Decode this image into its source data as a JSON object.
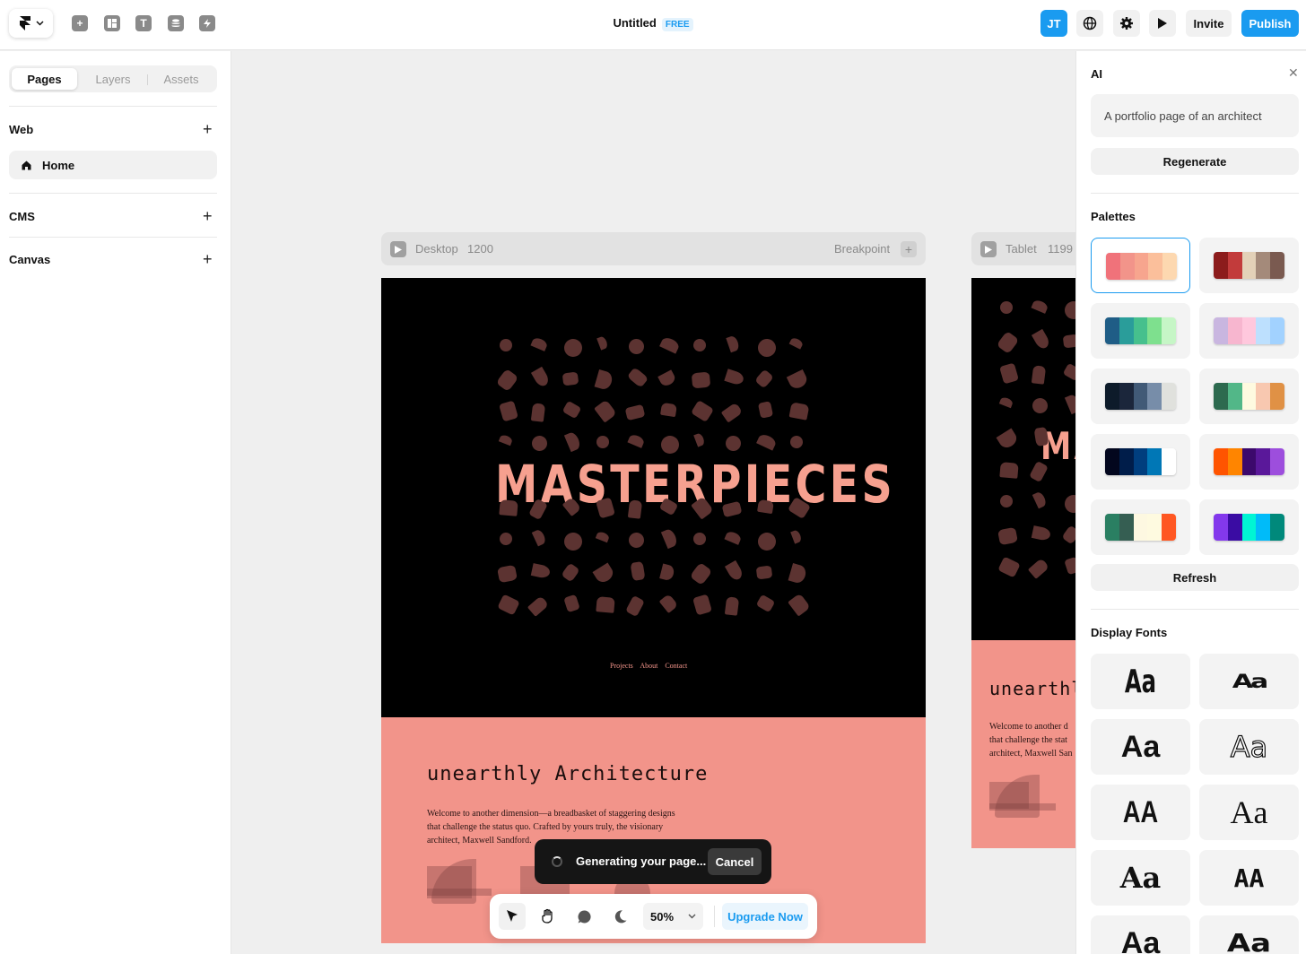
{
  "topbar": {
    "title": "Untitled",
    "plan_badge": "FREE",
    "avatar_initials": "JT",
    "invite_label": "Invite",
    "publish_label": "Publish",
    "accent_color": "#1a9bf0",
    "tool_icons": [
      "insert-icon",
      "layout-icon",
      "text-icon",
      "cms-icon",
      "plugins-icon"
    ]
  },
  "sidebar": {
    "tabs": [
      {
        "label": "Pages",
        "active": true
      },
      {
        "label": "Layers",
        "active": false
      },
      {
        "label": "Assets",
        "active": false
      }
    ],
    "sections": {
      "web": "Web",
      "cms": "CMS",
      "canvas": "Canvas"
    },
    "pages": [
      {
        "label": "Home",
        "icon": "home-icon"
      }
    ]
  },
  "canvas": {
    "desktop": {
      "name": "Desktop",
      "width": "1200",
      "breakpoint_label": "Breakpoint"
    },
    "tablet": {
      "name": "Tablet",
      "width": "1199"
    },
    "hero_title": "MASTERPIECES",
    "hero_title_tablet": "MA",
    "nav_links": "Projects About Contact",
    "section_title": "unearthly Architecture",
    "section_title_tablet": "unearthly",
    "body_lines": [
      "Welcome to another dimension—a breadbasket of staggering designs",
      "that challenge the status quo. Crafted by yours truly, the visionary",
      "architect, Maxwell Sandford."
    ],
    "body_lines_tablet": [
      "Welcome to another d",
      "that challenge the stat",
      "architect, Maxwell San"
    ],
    "hero_bg": "#000000",
    "shape_color": "#5c3331",
    "title_color": "#f6a08f",
    "section_bg": "#f2948a"
  },
  "toast": {
    "message": "Generating your page...",
    "cancel_label": "Cancel"
  },
  "toolbar": {
    "zoom": "50%",
    "upgrade_label": "Upgrade Now"
  },
  "ai_panel": {
    "title": "AI",
    "prompt": "A portfolio page of an architect",
    "regenerate_label": "Regenerate",
    "palettes_label": "Palettes",
    "refresh_label": "Refresh",
    "fonts_label": "Display Fonts",
    "palettes": [
      [
        "#f0727a",
        "#f2948a",
        "#f7a58e",
        "#fbbf9b",
        "#fdd8b0"
      ],
      [
        "#8c1c1c",
        "#c23b3b",
        "#e3d1b8",
        "#a48a7a",
        "#7a5a50"
      ],
      [
        "#1f5d86",
        "#2a9d9a",
        "#46c08d",
        "#7ee08e",
        "#c6f6c6"
      ],
      [
        "#c9b6e0",
        "#f7b6cf",
        "#ffc8dd",
        "#bde0fe",
        "#a2d2ff"
      ],
      [
        "#0d1b2a",
        "#1b263b",
        "#415a77",
        "#778da9",
        "#e0e1dd"
      ],
      [
        "#2d6a4f",
        "#52b788",
        "#fefae0",
        "#f8c8b0",
        "#e09145"
      ],
      [
        "#03071e",
        "#001d4a",
        "#003e7e",
        "#0077b6",
        "#ffffff"
      ],
      [
        "#ff5400",
        "#ff8500",
        "#3c096c",
        "#5a189a",
        "#9d4edd"
      ],
      [
        "#2a7f62",
        "#355e52",
        "#fdf8e1",
        "#fefae0",
        "#ff5722"
      ],
      [
        "#8338ec",
        "#3a0ca3",
        "#00f5d4",
        "#00bbf9",
        "#00897b"
      ]
    ],
    "font_samples": [
      "Aa",
      "Aa",
      "Aa",
      "Aa",
      "AA",
      "Aa",
      "Aa",
      "AA",
      "Aa",
      "Aa"
    ]
  }
}
